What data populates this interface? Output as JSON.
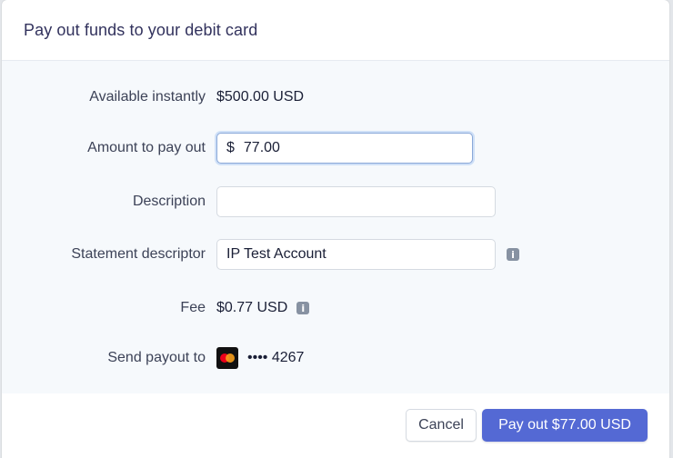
{
  "modal": {
    "title": "Pay out funds to your debit card"
  },
  "form": {
    "available": {
      "label": "Available instantly",
      "value": "$500.00 USD"
    },
    "amount": {
      "label": "Amount to pay out",
      "currency_symbol": "$",
      "value": "77.00"
    },
    "description": {
      "label": "Description",
      "value": ""
    },
    "statement": {
      "label": "Statement descriptor",
      "value": "IP Test Account",
      "info_icon": "info-icon"
    },
    "fee": {
      "label": "Fee",
      "value": "$0.77 USD",
      "info_icon": "info-icon"
    },
    "payout_to": {
      "label": "Send payout to",
      "card_icon": "mastercard-icon",
      "card_last4": "•••• 4267"
    }
  },
  "footer": {
    "cancel_label": "Cancel",
    "submit_label": "Pay out $77.00 USD"
  },
  "colors": {
    "primary": "#5469d4",
    "body_bg": "#f6f9fc",
    "focus_ring": "#cfe0f7"
  }
}
